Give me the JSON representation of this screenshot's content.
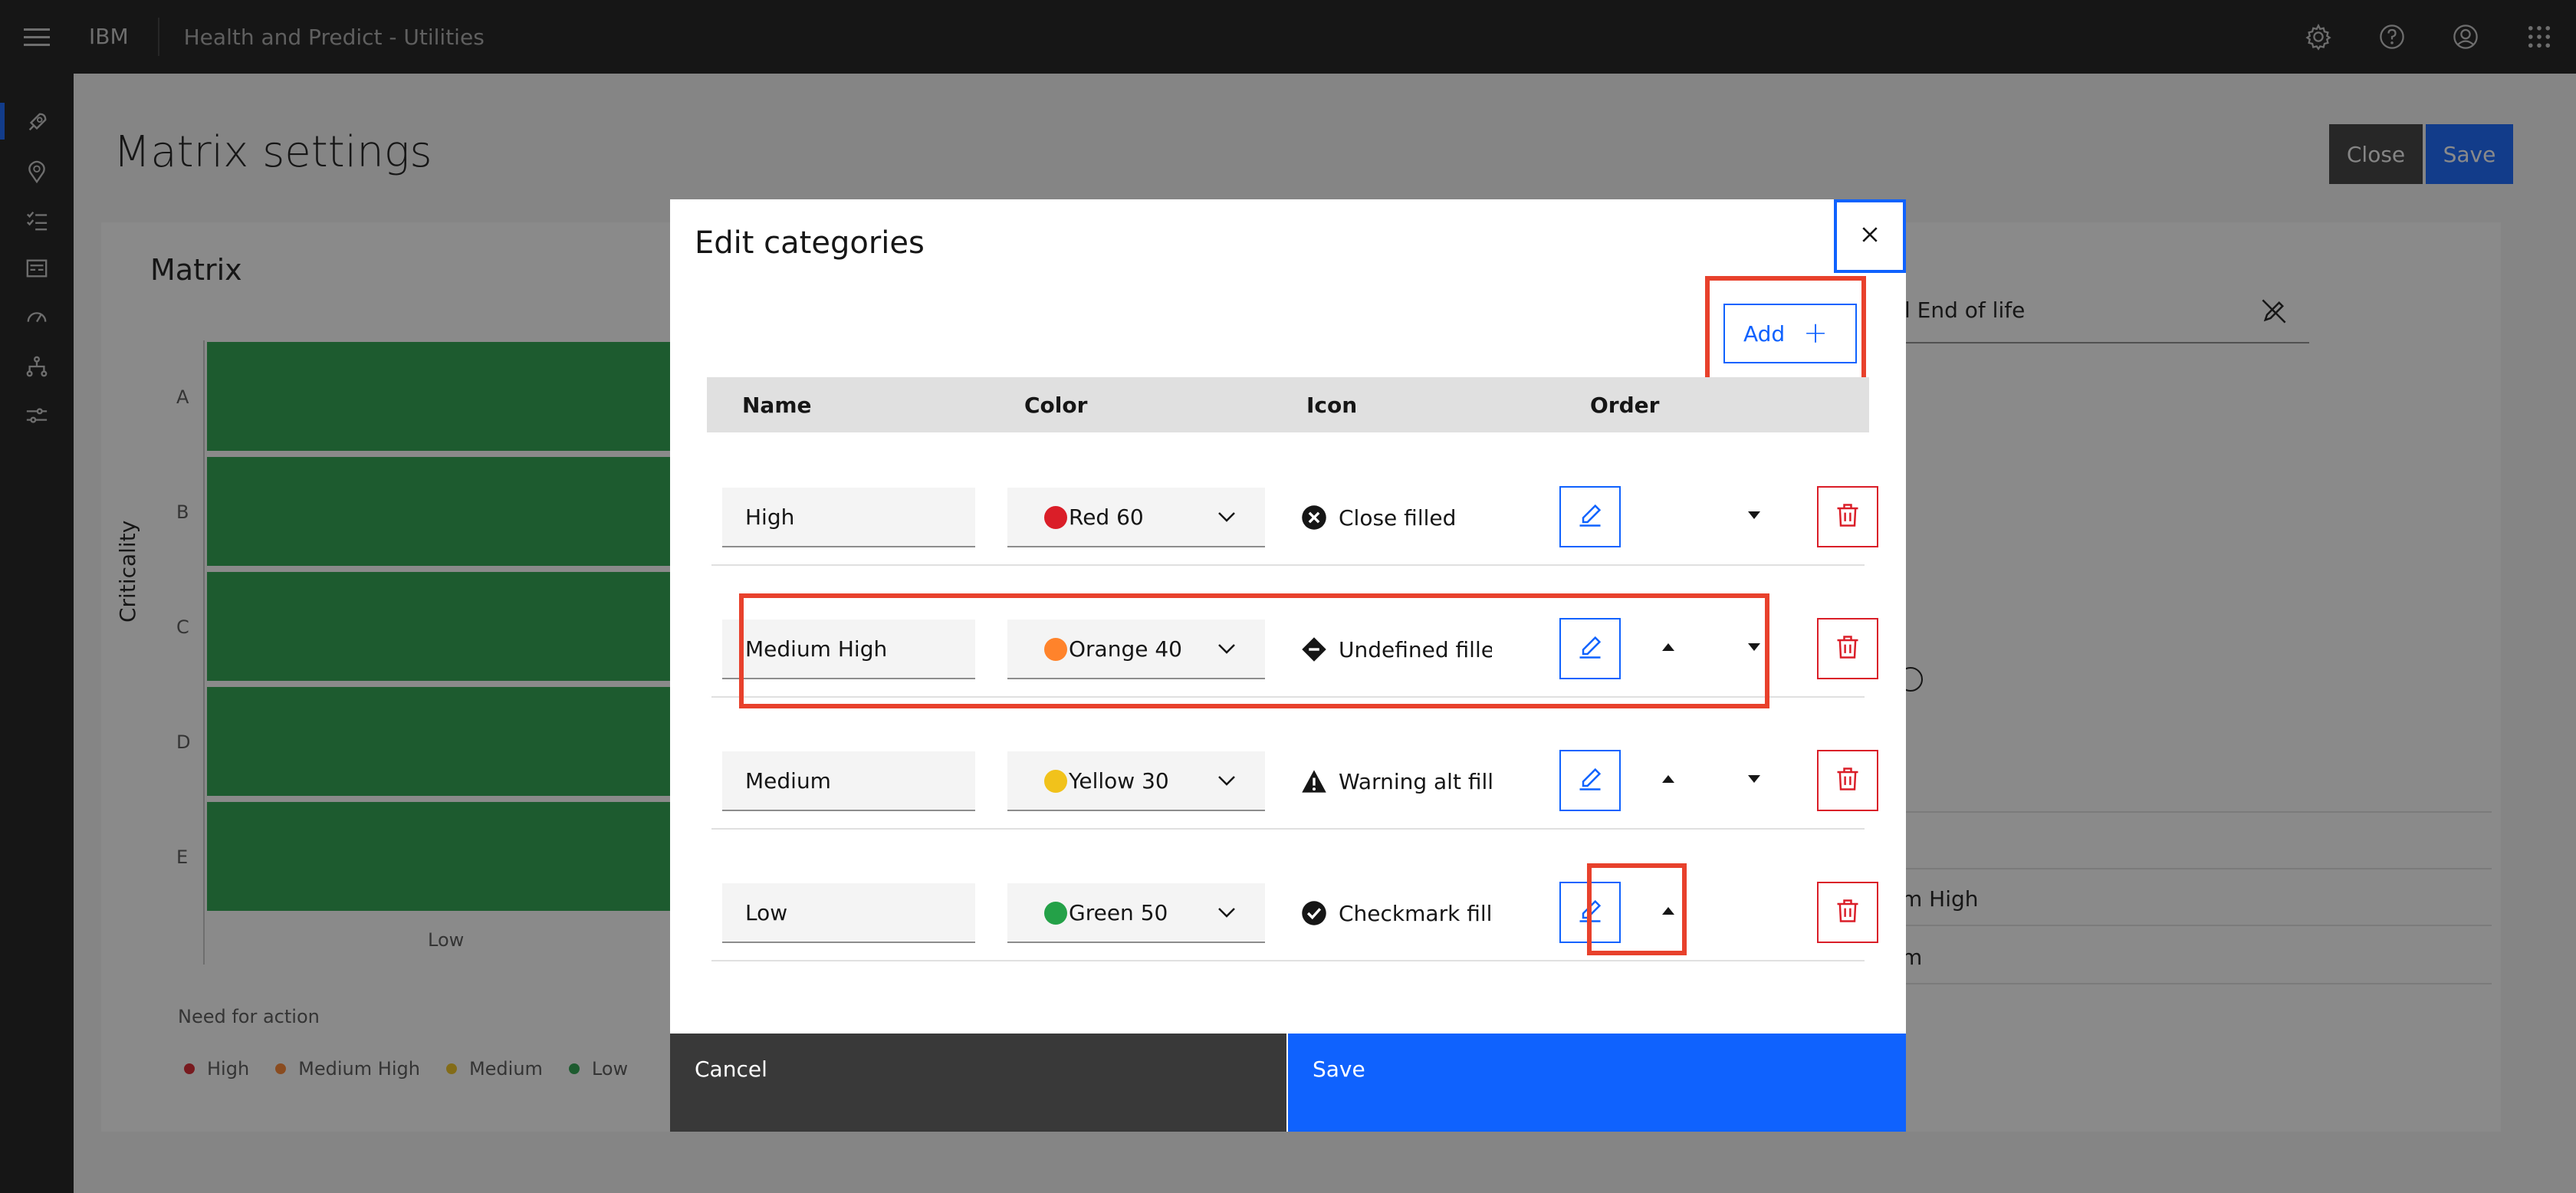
{
  "header": {
    "brand": "IBM",
    "app_name": "Health and Predict - Utilities",
    "icons": [
      "settings-icon",
      "help-icon",
      "user-avatar-icon",
      "app-switcher-icon"
    ]
  },
  "leftnav": {
    "icons": [
      "rocket-icon",
      "location-icon",
      "task-list-icon",
      "dashboard-icon",
      "gauge-icon",
      "hierarchy-icon",
      "sliders-icon"
    ]
  },
  "page": {
    "title": "Matrix settings",
    "close_label": "Close",
    "save_label": "Save"
  },
  "matrix": {
    "title": "Matrix",
    "y_label": "Criticality",
    "rows": [
      "A",
      "B",
      "C",
      "D",
      "E"
    ],
    "x_label_low": "Low",
    "cell_color": "#24a148",
    "legend_title": "Need for action",
    "legend": [
      {
        "label": "High",
        "color": "#da1e28"
      },
      {
        "label": "Medium High",
        "color": "#ff832b"
      },
      {
        "label": "Medium",
        "color": "#f1c21b"
      },
      {
        "label": "Low",
        "color": "#24a148"
      }
    ]
  },
  "background_panel": {
    "field_text": "l End of life",
    "text_medium_high": "m High",
    "text_medium": "m"
  },
  "modal": {
    "title": "Edit categories",
    "add_label": "Add",
    "columns": {
      "name": "Name",
      "color": "Color",
      "icon": "Icon",
      "order": "Order"
    },
    "rows": [
      {
        "name": "High",
        "color_label": "Red 60",
        "color_hex": "#da1e28",
        "icon_label": "Close filled",
        "icon": "close-filled-icon",
        "can_move_up": false,
        "can_move_down": true
      },
      {
        "name": "Medium High",
        "color_label": "Orange 40",
        "color_hex": "#ff832b",
        "icon_label": "Undefined filled",
        "icon": "undefined-filled-icon",
        "can_move_up": true,
        "can_move_down": true
      },
      {
        "name": "Medium",
        "color_label": "Yellow 30",
        "color_hex": "#f1c21b",
        "icon_label": "Warning alt filled",
        "icon": "warning-alt-filled-icon",
        "can_move_up": true,
        "can_move_down": true
      },
      {
        "name": "Low",
        "color_label": "Green 50",
        "color_hex": "#24a148",
        "icon_label": "Checkmark filled",
        "icon": "checkmark-filled-icon",
        "can_move_up": true,
        "can_move_down": false
      }
    ],
    "cancel_label": "Cancel",
    "save_label": "Save"
  },
  "colors": {
    "accent": "#0f62fe",
    "danger": "#da1e28",
    "highlight": "#e8412c",
    "header_bg": "#161616"
  }
}
